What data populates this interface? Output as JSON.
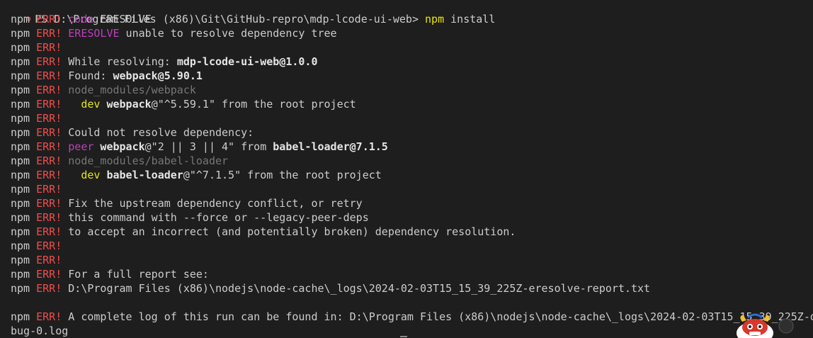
{
  "terminal": {
    "prompt": {
      "icon": "error-circle-icon",
      "ps": "PS D:\\Program Files (x86)\\Git\\GitHub-repro\\mdp-lcode-ui-web>",
      "command": "npm",
      "args": "install"
    },
    "npm_prefix": "npm",
    "err_prefix": "ERR!",
    "lines": [
      {
        "text": [
          {
            "t": "code",
            "c": "magenta"
          },
          {
            "t": " ERESOLVE",
            "c": "white"
          }
        ]
      },
      {
        "text": [
          {
            "t": "ERESOLVE",
            "c": "magenta"
          },
          {
            "t": " unable to resolve dependency tree",
            "c": "white"
          }
        ]
      },
      {
        "text": []
      },
      {
        "text": [
          {
            "t": "While resolving: ",
            "c": "white"
          },
          {
            "t": "mdp-lcode-ui-web",
            "c": "bold"
          },
          {
            "t": "@1.0.0",
            "c": "bold"
          }
        ]
      },
      {
        "text": [
          {
            "t": "Found: ",
            "c": "white"
          },
          {
            "t": "webpack",
            "c": "bold"
          },
          {
            "t": "@5.90.1",
            "c": "bold"
          }
        ]
      },
      {
        "text": [
          {
            "t": "node_modules/webpack",
            "c": "gray"
          }
        ]
      },
      {
        "text": [
          {
            "t": "  dev",
            "c": "yellow"
          },
          {
            "t": " webpack",
            "c": "bold"
          },
          {
            "t": "@\"^5.59.1\"",
            "c": "white"
          },
          {
            "t": " from the root project",
            "c": "white"
          }
        ]
      },
      {
        "text": []
      },
      {
        "text": [
          {
            "t": "Could not resolve dependency:",
            "c": "white"
          }
        ]
      },
      {
        "text": [
          {
            "t": "peer",
            "c": "magenta"
          },
          {
            "t": " webpack",
            "c": "bold"
          },
          {
            "t": "@\"2 || 3 || 4\"",
            "c": "white"
          },
          {
            "t": " from ",
            "c": "white"
          },
          {
            "t": "babel-loader",
            "c": "bold"
          },
          {
            "t": "@7.1.5",
            "c": "bold"
          }
        ]
      },
      {
        "text": [
          {
            "t": "node_modules/babel-loader",
            "c": "gray"
          }
        ]
      },
      {
        "text": [
          {
            "t": "  dev",
            "c": "yellow"
          },
          {
            "t": " babel-loader",
            "c": "bold"
          },
          {
            "t": "@\"^7.1.5\"",
            "c": "white"
          },
          {
            "t": " from the root project",
            "c": "white"
          }
        ]
      },
      {
        "text": []
      },
      {
        "text": [
          {
            "t": "Fix the upstream dependency conflict, or retry",
            "c": "white"
          }
        ]
      },
      {
        "text": [
          {
            "t": "this command with --force or --legacy-peer-deps",
            "c": "white"
          }
        ]
      },
      {
        "text": [
          {
            "t": "to accept an incorrect (and potentially broken) dependency resolution.",
            "c": "white"
          }
        ]
      },
      {
        "text": []
      },
      {
        "text": []
      },
      {
        "text": [
          {
            "t": "For a full report see:",
            "c": "white"
          }
        ]
      },
      {
        "text": [
          {
            "t": "D:\\Program Files (x86)\\nodejs\\node-cache\\_logs\\2024-02-03T15_15_39_225Z-eresolve-report.txt",
            "c": "white"
          }
        ]
      },
      {
        "blank": true
      },
      {
        "text": [
          {
            "t": "A complete log of this run can be found in: D:\\Program Files (x86)\\nodejs\\node-cache\\_logs\\2024-02-03T15_15_39_225Z-de",
            "c": "white"
          }
        ]
      },
      {
        "plain": "bug-0.log"
      }
    ],
    "mascot_icon": "dragon-mascot-icon"
  }
}
